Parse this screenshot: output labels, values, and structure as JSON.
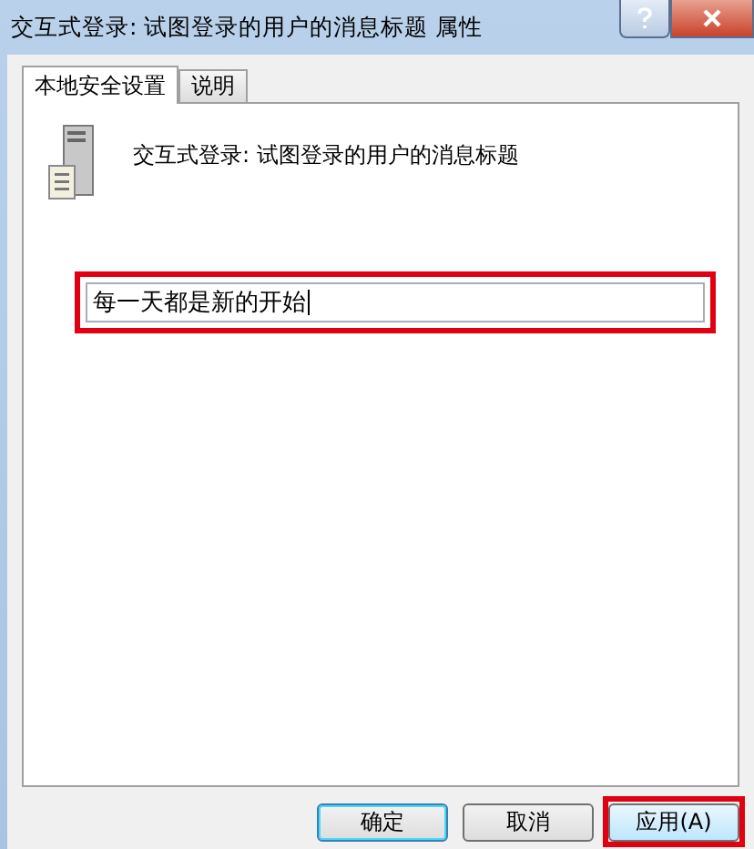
{
  "window": {
    "title": "交互式登录: 试图登录的用户的消息标题 属性"
  },
  "tabs": [
    {
      "label": "本地安全设置",
      "selected": true
    },
    {
      "label": "说明",
      "selected": false
    }
  ],
  "policy": {
    "title": "交互式登录: 试图登录的用户的消息标题"
  },
  "field": {
    "value": "每一天都是新的开始",
    "highlighted": true
  },
  "buttons": [
    {
      "label": "确定",
      "default": true,
      "highlighted": false
    },
    {
      "label": "取消",
      "default": false,
      "highlighted": false
    },
    {
      "label": "应用(A)",
      "default": false,
      "highlighted": true
    }
  ]
}
